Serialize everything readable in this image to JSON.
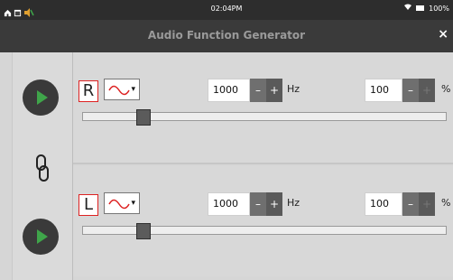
{
  "status_bar": {
    "time": "02:04PM",
    "battery": "100%",
    "icons": [
      "home-icon",
      "window-icon",
      "speaker-icon",
      "wifi-icon",
      "battery-icon"
    ]
  },
  "window": {
    "title": "Audio Function Generator",
    "close_label": "×"
  },
  "channels": [
    {
      "label": "R",
      "waveform": "sine",
      "frequency": "1000",
      "frequency_unit": "Hz",
      "amplitude": "100",
      "amplitude_unit": "%",
      "minus_label": "–",
      "plus_label": "+",
      "slider_value": 0.1
    },
    {
      "label": "L",
      "waveform": "sine",
      "frequency": "1000",
      "frequency_unit": "Hz",
      "amplitude": "100",
      "amplitude_unit": "%",
      "minus_label": "–",
      "plus_label": "+",
      "slider_value": 0.1
    }
  ],
  "colors": {
    "accent_red": "#dd2222",
    "play_green": "#3fa54a",
    "background": "#d6d6d6"
  }
}
